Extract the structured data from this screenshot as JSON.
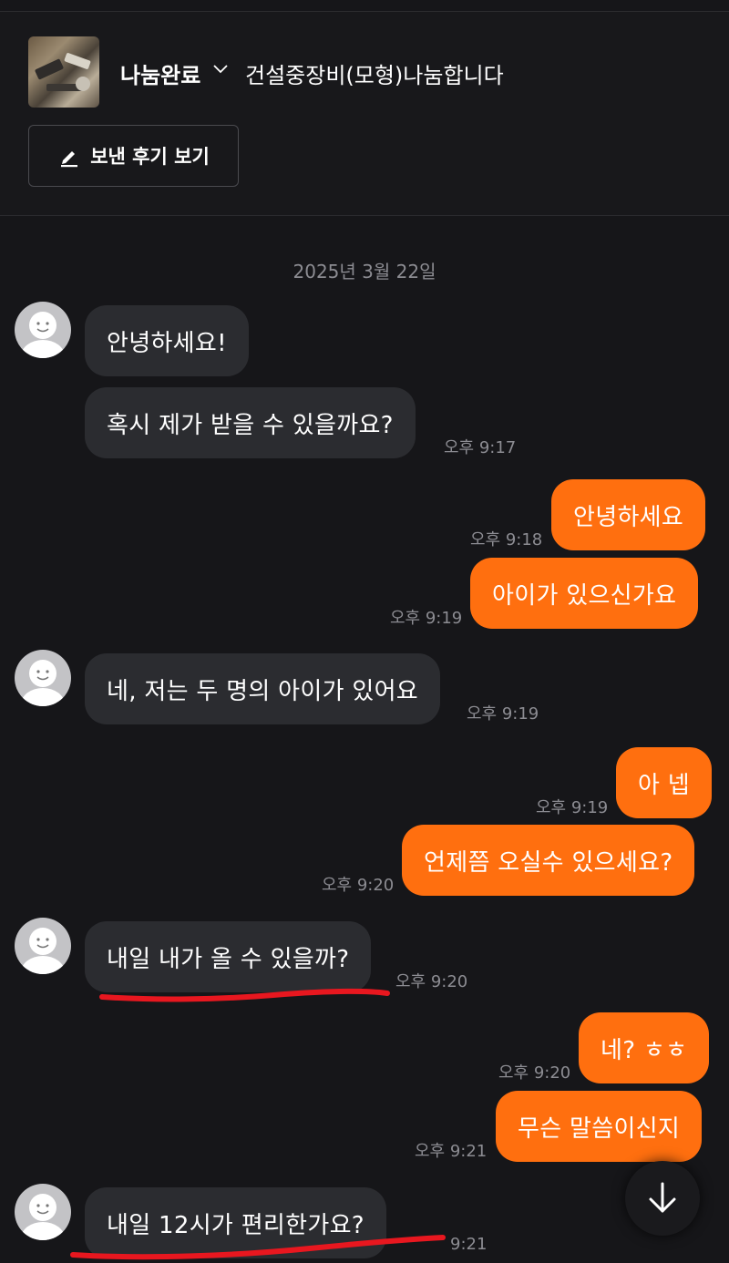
{
  "product": {
    "status": "나눔완료",
    "title": "건설중장비(모형)나눔합니다",
    "review_button": "보낸 후기 보기"
  },
  "date_divider": "2025년 3월 22일",
  "messages": [
    {
      "text": "안녕하세요!",
      "time": ""
    },
    {
      "text": "혹시 제가 받을 수 있을까요?",
      "time": "오후 9:17"
    },
    {
      "text": "안녕하세요",
      "time": "오후 9:18"
    },
    {
      "text": "아이가 있으신가요",
      "time": "오후 9:19"
    },
    {
      "text": "네, 저는 두 명의 아이가 있어요",
      "time": "오후 9:19"
    },
    {
      "text": "아 넵",
      "time": "오후 9:19"
    },
    {
      "text": "언제쯤 오실수 있으세요?",
      "time": "오후 9:20"
    },
    {
      "text": "내일 내가 올 수 있을까?",
      "time": "오후 9:20"
    },
    {
      "text": "네? ㅎㅎ",
      "time": "오후 9:20"
    },
    {
      "text": "무슨 말씀이신지",
      "time": "오후 9:21"
    },
    {
      "text": "내일 12시가 편리한가요?",
      "time": "9:21"
    }
  ],
  "colors": {
    "background": "#161619",
    "incoming_bubble": "#2b2c30",
    "outgoing_bubble": "#ff6f0f",
    "timestamp": "#8c8c92",
    "annotation": "#e8171f"
  }
}
